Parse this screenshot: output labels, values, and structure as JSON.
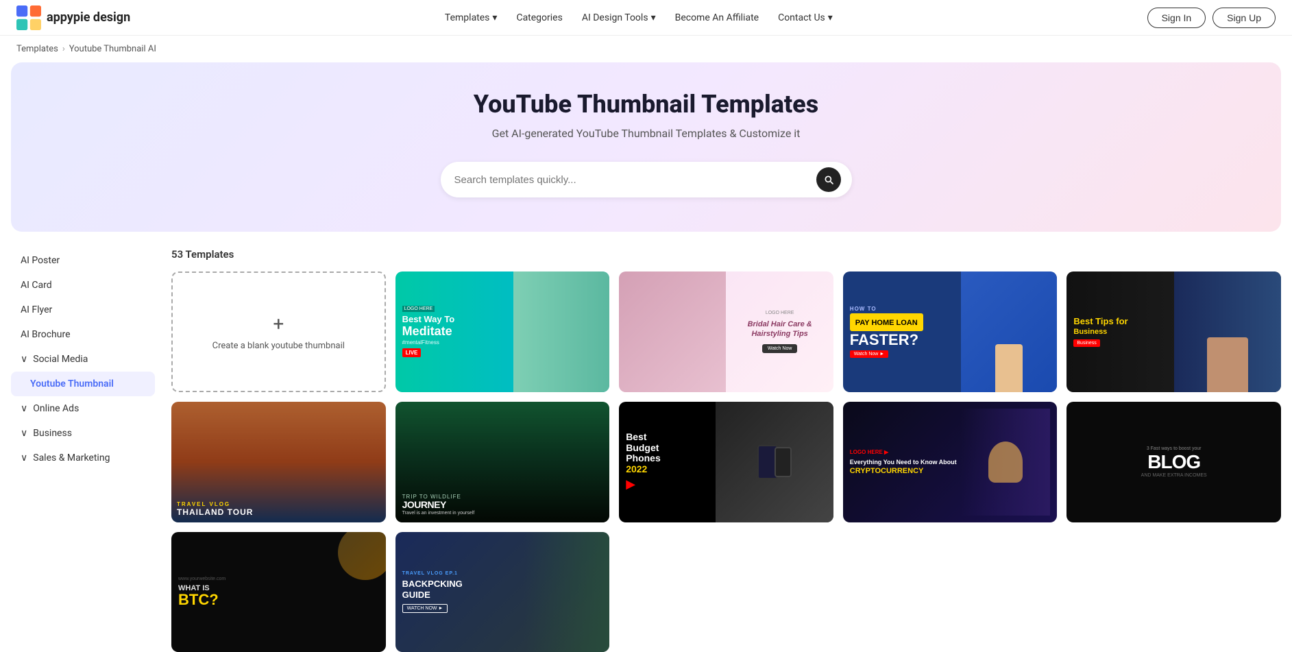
{
  "header": {
    "logo_text": "appypie design",
    "nav": [
      {
        "label": "Templates",
        "has_dropdown": true
      },
      {
        "label": "Categories",
        "has_dropdown": false
      },
      {
        "label": "AI Design Tools",
        "has_dropdown": true
      },
      {
        "label": "Become An Affiliate",
        "has_dropdown": false
      },
      {
        "label": "Contact Us",
        "has_dropdown": true
      }
    ],
    "signin_label": "Sign In",
    "signup_label": "Sign Up"
  },
  "breadcrumb": {
    "items": [
      {
        "label": "Templates",
        "link": true
      },
      {
        "label": "Youtube Thumbnail AI",
        "link": false
      }
    ]
  },
  "hero": {
    "title": "YouTube Thumbnail Templates",
    "subtitle": "Get AI-generated YouTube Thumbnail Templates & Customize it",
    "search_placeholder": "Search templates quickly..."
  },
  "sidebar": {
    "items": [
      {
        "label": "AI Poster",
        "id": "ai-poster",
        "active": false
      },
      {
        "label": "AI Card",
        "id": "ai-card",
        "active": false
      },
      {
        "label": "AI Flyer",
        "id": "ai-flyer",
        "active": false
      },
      {
        "label": "AI Brochure",
        "id": "ai-brochure",
        "active": false
      },
      {
        "label": "Social Media",
        "id": "social-media",
        "group": true,
        "expanded": true
      },
      {
        "label": "Youtube Thumbnail",
        "id": "youtube-thumbnail",
        "active": true,
        "indent": true
      },
      {
        "label": "Online Ads",
        "id": "online-ads",
        "group": true,
        "expanded": false
      },
      {
        "label": "Business",
        "id": "business",
        "group": true,
        "expanded": false
      },
      {
        "label": "Sales & Marketing",
        "id": "sales-marketing",
        "group": true,
        "expanded": false
      }
    ]
  },
  "content": {
    "templates_count": "53 Templates",
    "create_blank_label": "Create a blank youtube thumbnail",
    "templates": [
      {
        "id": "meditate",
        "title": "Best Way To Meditate"
      },
      {
        "id": "bridal",
        "title": "Bridal Hair Care & Hairstyling Tips"
      },
      {
        "id": "loan",
        "title": "How To Pay Home Loan Faster?"
      },
      {
        "id": "business",
        "title": "Best Tips for Business"
      },
      {
        "id": "thailand",
        "title": "Thailand Tour"
      },
      {
        "id": "wildlife",
        "title": "Trip To Wildlife Journey"
      },
      {
        "id": "phones",
        "title": "Best Budget Phones 2022"
      },
      {
        "id": "crypto",
        "title": "Everything You Need to Know About Cryptocurrency"
      },
      {
        "id": "blog",
        "title": "Blog Make Extra Incomes"
      },
      {
        "id": "btc",
        "title": "What Is BTC?"
      },
      {
        "id": "backpacking",
        "title": "Backpacking Guide"
      }
    ]
  }
}
